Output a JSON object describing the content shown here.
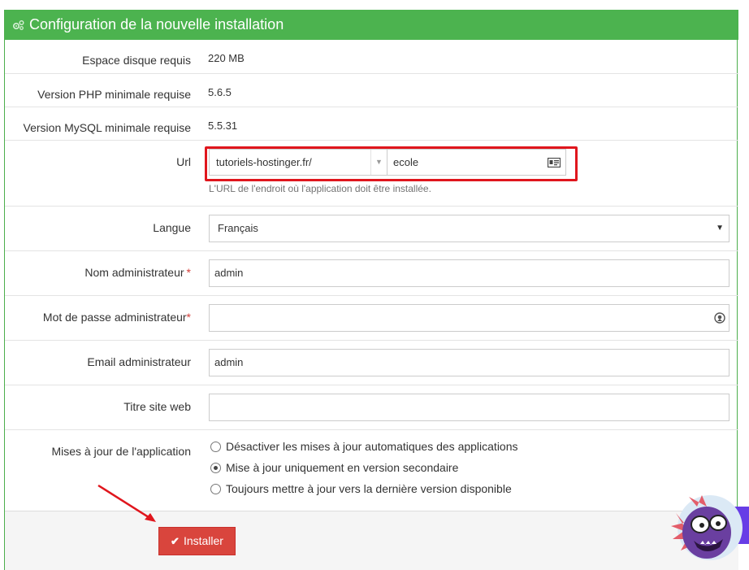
{
  "panel": {
    "title": "Configuration de la nouvelle installation",
    "title_icon": "cogs-icon",
    "header_color": "#4cb34f"
  },
  "requirements": {
    "disk_label": "Espace disque requis",
    "disk_value": "220 MB",
    "php_label": "Version PHP minimale requise",
    "php_value": "5.6.5",
    "mysql_label": "Version MySQL minimale requise",
    "mysql_value": "5.5.31"
  },
  "url": {
    "label": "Url",
    "domain_selected": "tutoriels-hostinger.fr/",
    "directory_value": "ecole",
    "directory_icon": "id-card-icon",
    "help": "L'URL de l'endroit où l'application doit être installée.",
    "highlight_color": "#e0161d"
  },
  "language": {
    "label": "Langue",
    "selected": "Français"
  },
  "admin_name": {
    "label": "Nom administrateur",
    "required_mark": "*",
    "value": "admin"
  },
  "admin_password": {
    "label": "Mot de passe administrateur",
    "required_mark": "*",
    "value": "",
    "icon": "eye-icon"
  },
  "admin_email": {
    "label": "Email administrateur",
    "value": "admin"
  },
  "site_title": {
    "label": "Titre site web",
    "value": ""
  },
  "updates": {
    "label": "Mises à jour de l'application",
    "options": [
      {
        "label": "Désactiver les mises à jour automatiques des applications",
        "checked": false
      },
      {
        "label": "Mise à jour uniquement en version secondaire",
        "checked": true
      },
      {
        "label": "Toujours mettre à jour vers la dernière version disponible",
        "checked": false
      }
    ]
  },
  "footer": {
    "install_label": "Installer",
    "install_icon": "check-icon",
    "install_color": "#d9453d"
  },
  "annotations": {
    "arrow_color": "#e0161d",
    "mascot": "mascot-icon"
  }
}
